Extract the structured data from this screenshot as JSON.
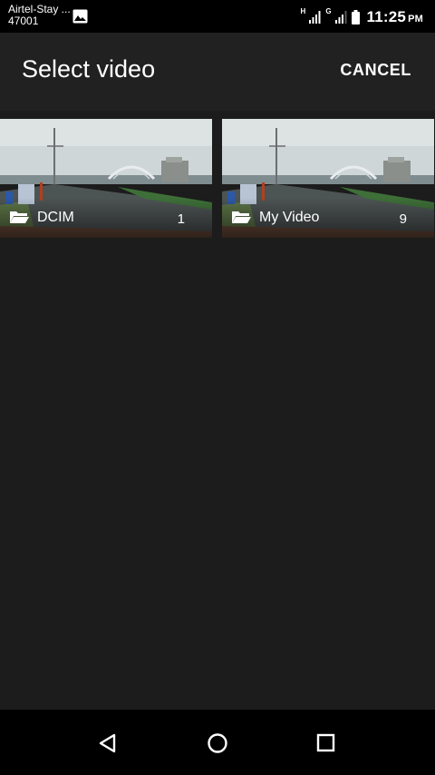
{
  "status_bar": {
    "carrier_line1": "Airtel-Stay ...",
    "carrier_line2": "47001",
    "net1_label": "H",
    "net2_label": "G",
    "time": "11:25",
    "ampm": "PM",
    "icons": [
      "image-notification-icon",
      "signal-icon",
      "signal-icon",
      "battery-icon"
    ]
  },
  "toolbar": {
    "title": "Select video",
    "cancel_label": "CANCEL"
  },
  "albums": [
    {
      "name": "DCIM",
      "count": "1",
      "icon": "folder-icon"
    },
    {
      "name": "My Video",
      "count": "9",
      "icon": "folder-icon"
    }
  ],
  "nav_bar": {
    "icons": [
      "back-icon",
      "home-icon",
      "recents-icon"
    ]
  },
  "colors": {
    "status_bar_bg": "#000000",
    "toolbar_bg": "#212121",
    "content_bg": "#1c1c1c",
    "text": "#ffffff"
  }
}
